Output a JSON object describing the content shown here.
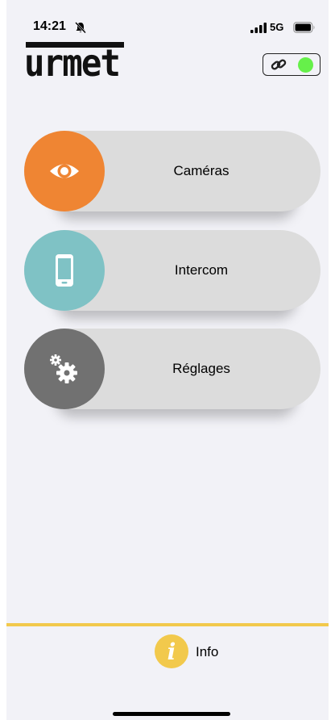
{
  "status_bar": {
    "time": "14:21",
    "network": "5G",
    "icons": [
      "bell-slash-icon",
      "signal-bars-icon",
      "battery-icon"
    ]
  },
  "header": {
    "logo_text": "urmet",
    "connection": {
      "icon": "link-icon",
      "status": "connected",
      "status_color": "#66f04a"
    }
  },
  "menu": {
    "items": [
      {
        "id": "cameras",
        "label": "Caméras",
        "icon": "eye-icon",
        "color": "#ef8533"
      },
      {
        "id": "intercom",
        "label": "Intercom",
        "icon": "smartphone-icon",
        "color": "#7fc2c5"
      },
      {
        "id": "settings",
        "label": "Réglages",
        "icon": "gears-icon",
        "color": "#717171"
      }
    ]
  },
  "footer": {
    "info_label": "Info",
    "info_icon": "info-icon",
    "accent_color": "#f2c94c"
  }
}
